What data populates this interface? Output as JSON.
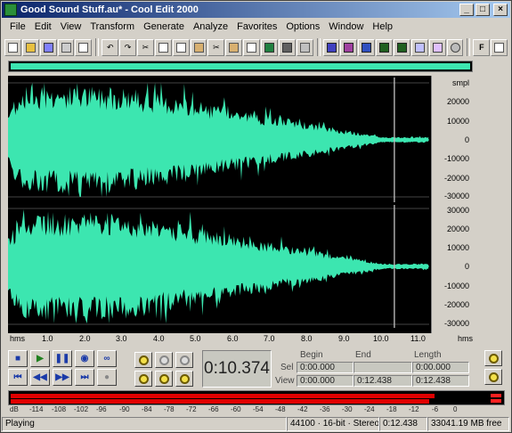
{
  "window": {
    "title": "Good Sound Stuff.au* - Cool Edit 2000"
  },
  "menu": [
    "File",
    "Edit",
    "View",
    "Transform",
    "Generate",
    "Analyze",
    "Favorites",
    "Options",
    "Window",
    "Help"
  ],
  "scale": {
    "unit": "smpl",
    "ch1": [
      "20000",
      "10000",
      "0",
      "-10000",
      "-20000",
      "-30000"
    ],
    "ch2": [
      "30000",
      "20000",
      "10000",
      "0",
      "-10000",
      "-20000",
      "-30000"
    ]
  },
  "time_ruler": {
    "unit_left": "hms",
    "unit_right": "hms",
    "ticks": [
      "1.0",
      "2.0",
      "3.0",
      "4.0",
      "5.0",
      "6.0",
      "7.0",
      "8.0",
      "9.0",
      "10.0",
      "11.0"
    ]
  },
  "time_display": "0:10.374",
  "selview": {
    "headers": {
      "begin": "Begin",
      "end": "End",
      "length": "Length"
    },
    "sel_label": "Sel",
    "view_label": "View",
    "sel": {
      "begin": "0:00.000",
      "end": "",
      "length": "0:00.000"
    },
    "view": {
      "begin": "0:00.000",
      "end": "0:12.438",
      "length": "0:12.438"
    }
  },
  "meter_scale": [
    "dB",
    "-114",
    "-108",
    "-102",
    "-96",
    "-90",
    "-84",
    "-78",
    "-72",
    "-66",
    "-60",
    "-54",
    "-48",
    "-42",
    "-36",
    "-30",
    "-24",
    "-18",
    "-12",
    "-6",
    "0"
  ],
  "status": {
    "state": "Playing",
    "format": "44100 · 16-bit · Stereo",
    "length": "0:12.438",
    "free": "33041.19 MB free"
  },
  "colors": {
    "waveform": "#3ce6b0",
    "background": "#000000",
    "meter": "#e00000"
  }
}
